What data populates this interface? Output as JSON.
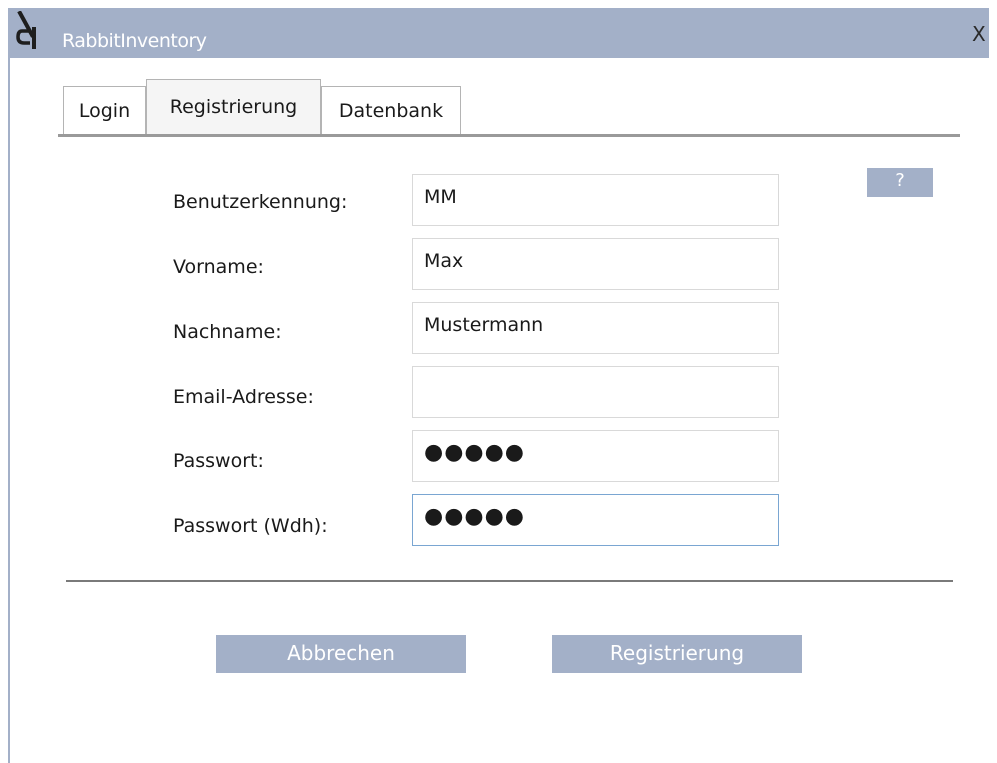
{
  "window": {
    "title": "RabbitInventory",
    "close_label": "X"
  },
  "tabs": [
    {
      "label": "Login",
      "active": false
    },
    {
      "label": "Registrierung",
      "active": true
    },
    {
      "label": "Datenbank",
      "active": false
    }
  ],
  "help_button": {
    "label": "?"
  },
  "form": {
    "fields": [
      {
        "label": "Benutzerkennung:",
        "value": "MM",
        "type": "text"
      },
      {
        "label": "Vorname:",
        "value": "Max",
        "type": "text"
      },
      {
        "label": "Nachname:",
        "value": "Mustermann",
        "type": "text"
      },
      {
        "label": "Email-Adresse:",
        "value": "",
        "type": "text"
      },
      {
        "label": "Passwort:",
        "value": "●●●●●",
        "type": "password"
      },
      {
        "label": "Passwort (Wdh):",
        "value": "●●●●●",
        "type": "password",
        "focused": true
      }
    ]
  },
  "buttons": {
    "cancel_label": "Abbrechen",
    "register_label": "Registrierung"
  },
  "colors": {
    "titlebar": "#a3b0c8",
    "button": "#a3b0c8",
    "focus_border": "#7aa6d2"
  }
}
